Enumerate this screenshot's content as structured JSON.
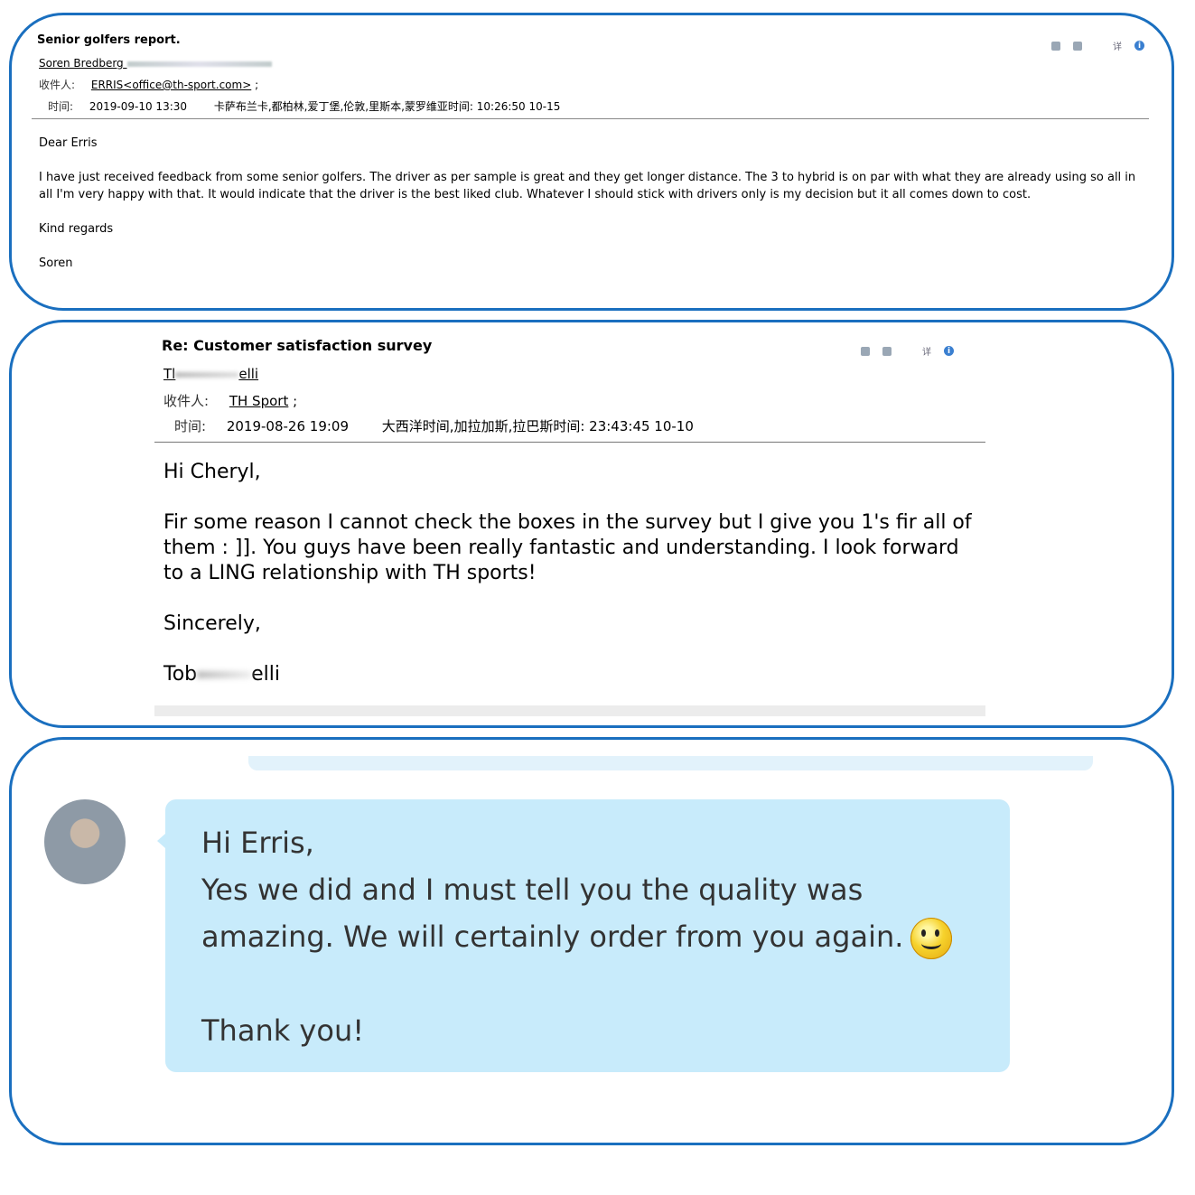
{
  "email1": {
    "subject": "Senior golfers report.",
    "from_name": "Soren Bredberg",
    "to_label": "收件人:",
    "to_value": "ERRIS<office@th-sport.com>",
    "to_sep": ";",
    "time_label": "时间:",
    "time_value": "2019-09-10 13:30",
    "timezone": "卡萨布兰卡,都柏林,爱丁堡,伦敦,里斯本,蒙罗维亚时间: 10:26:50 10-15",
    "greeting": "Dear Erris",
    "body": "I have just received feedback from some senior golfers. The driver as per sample is great and they get longer distance. The 3 to hybrid is on par with what they are already using so all in all I'm very happy with that. It would indicate that the driver is the best liked club. Whatever I should stick with drivers only is my decision but it all comes down to cost.",
    "closing": "Kind regards",
    "signature": "Soren",
    "detail_label": "详"
  },
  "email2": {
    "subject": "Re: Customer satisfaction survey",
    "from_start": "Tl",
    "from_end": "elli",
    "to_label": "收件人:",
    "to_value": "TH Sport",
    "to_sep": ";",
    "time_label": "时间:",
    "time_value": "2019-08-26 19:09",
    "timezone": "大西洋时间,加拉加斯,拉巴斯时间: 23:43:45 10-10",
    "greeting": "Hi Cheryl,",
    "body": "Fir some reason I cannot check the boxes in the survey but I give you 1's fir all of them : ]]. You guys have been really fantastic and understanding. I look forward to a LING relationship with TH sports!",
    "closing": "Sincerely,",
    "signature_start": "Tob",
    "signature_end": "elli",
    "detail_label": "详"
  },
  "chat": {
    "greeting": "Hi Erris,",
    "line1": "Yes we did and I must tell you the quality was",
    "line2": "amazing. We will certainly order from you again.",
    "thanks": "Thank you!",
    "emoji": "smiley-icon"
  },
  "colors": {
    "panel_border": "#1a6fbf",
    "bubble": "#c8ebfb",
    "info_icon": "#3a7fd0"
  }
}
